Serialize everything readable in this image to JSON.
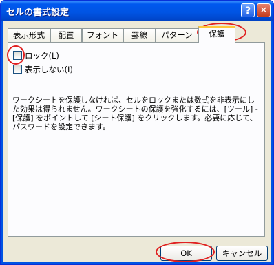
{
  "window": {
    "title": "セルの書式設定",
    "help_glyph": "?",
    "close_glyph": "✕"
  },
  "tabs": [
    {
      "label": "表示形式",
      "active": false
    },
    {
      "label": "配置",
      "active": false
    },
    {
      "label": "フォント",
      "active": false
    },
    {
      "label": "罫線",
      "active": false
    },
    {
      "label": "パターン",
      "active": false
    },
    {
      "label": "保護",
      "active": true
    }
  ],
  "protection": {
    "lock_label": "ロック(L)",
    "lock_checked": false,
    "hidden_label": "表示しない(I)",
    "hidden_checked": false,
    "description": "ワークシートを保護しなければ、セルをロックまたは数式を非表示にした効果は得られません。ワークシートの保護を強化するには、[ツール] - [保護] をポイントして [シート保護] をクリックします。必要に応じて、パスワードを設定できます。"
  },
  "buttons": {
    "ok_label": "OK",
    "cancel_label": "キャンセル"
  },
  "colors": {
    "titlebar": "#0054e3",
    "dialog_bg": "#ece9d8",
    "annotation": "#e02020"
  }
}
